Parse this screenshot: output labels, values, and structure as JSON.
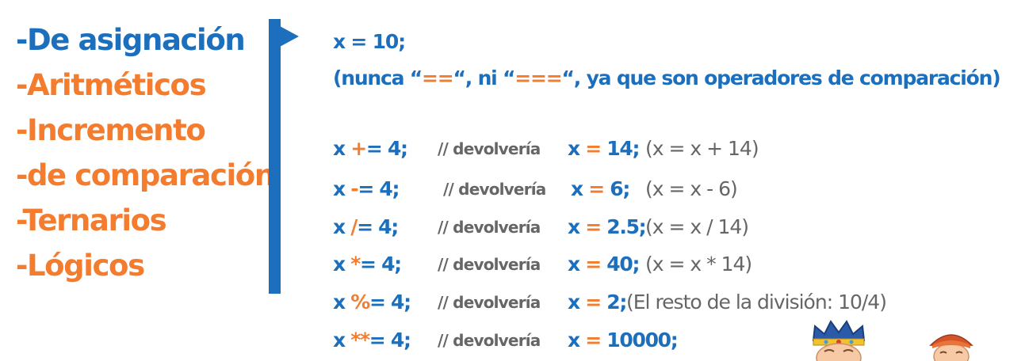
{
  "menu": {
    "items": [
      {
        "label": "-De asignación",
        "active": true
      },
      {
        "label": "-Aritméticos",
        "active": false
      },
      {
        "label": "-Incremento",
        "active": false
      },
      {
        "label": "-de comparación",
        "active": false
      },
      {
        "label": "-Ternarios",
        "active": false
      },
      {
        "label": "-Lógicos",
        "active": false
      }
    ]
  },
  "intro": {
    "assignment": "x = 10;",
    "note_open": "(nunca “",
    "note_eq2": "==",
    "note_mid": "“, ni “",
    "note_eq3": "===",
    "note_close": "“, ya que son operadores de comparación)"
  },
  "examples": [
    {
      "lhs": "x ",
      "sym": "+",
      "rest": "= 4;",
      "comment": "// devolvería",
      "res_x": "x ",
      "res_eq": "=",
      "res_val": " 14;",
      "explanation": "(x = x + 14)"
    },
    {
      "lhs": "x ",
      "sym": "-",
      "rest": "= 4;",
      "comment": "// devolvería",
      "res_x": "x ",
      "res_eq": "=",
      "res_val": " 6;",
      "explanation": "(x = x - 6)"
    },
    {
      "lhs": "x ",
      "sym": "/",
      "rest": "= 4;",
      "comment": "// devolvería",
      "res_x": "x ",
      "res_eq": "=",
      "res_val": " 2.5;",
      "explanation": "(x = x / 14)"
    },
    {
      "lhs": "x ",
      "sym": "*",
      "rest": "= 4;",
      "comment": "// devolvería",
      "res_x": "x ",
      "res_eq": "=",
      "res_val": " 40;",
      "explanation": "(x = x * 14)"
    },
    {
      "lhs": "x ",
      "sym": "%",
      "rest": "= 4;",
      "comment": "// devolvería",
      "res_x": "x ",
      "res_eq": "=",
      "res_val": " 2;",
      "explanation": "(El resto de la división: 10/4)"
    },
    {
      "lhs": "x ",
      "sym": "**",
      "rest": "= 4;",
      "comment": "// devolvería",
      "res_x": "x ",
      "res_eq": "=",
      "res_val": " 10000;",
      "explanation": ""
    }
  ],
  "colors": {
    "blue": "#1c6fbd",
    "orange": "#f37c2e",
    "gray": "#666666"
  },
  "icons": [
    "vertical-bar-arrow",
    "king-character-icon",
    "queen-character-icon"
  ]
}
